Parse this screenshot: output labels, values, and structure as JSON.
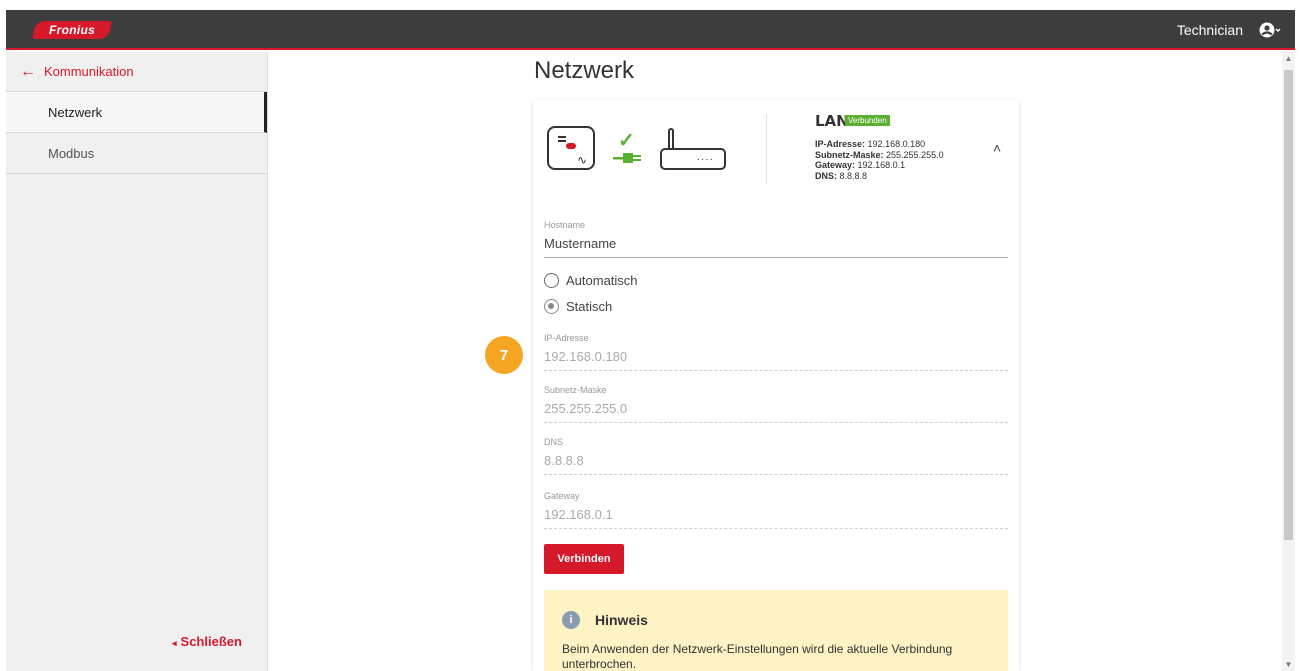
{
  "header": {
    "logo_text": "Fronius",
    "user_label": "Technician"
  },
  "sidebar": {
    "back_label": "Kommunikation",
    "items": [
      {
        "label": "Netzwerk",
        "active": true
      },
      {
        "label": "Modbus",
        "active": false
      }
    ],
    "close_label": "Schließen"
  },
  "main": {
    "title": "Netzwerk"
  },
  "lan": {
    "title": "LAN",
    "status_badge": "Verbunden",
    "ip_label": "IP-Adresse:",
    "ip_value": "192.168.0.180",
    "subnet_label": "Subnetz-Maske:",
    "subnet_value": "255.255.255.0",
    "gateway_label": "Gateway:",
    "gateway_value": "192.168.0.1",
    "dns_label": "DNS:",
    "dns_value": "8.8.8.8"
  },
  "form": {
    "hostname_label": "Hostname",
    "hostname_value": "Mustername",
    "radio_auto": "Automatisch",
    "radio_static": "Statisch",
    "selected_mode": "Statisch",
    "ip_label": "IP-Adresse",
    "ip_value": "192.168.0.180",
    "subnet_label": "Subnetz-Maske",
    "subnet_value": "255.255.255.0",
    "dns_label": "DNS",
    "dns_value": "8.8.8.8",
    "gateway_label": "Gateway",
    "gateway_value": "192.168.0.1",
    "connect_button": "Verbinden"
  },
  "hint": {
    "title": "Hinweis",
    "text": "Beim Anwenden der Netzwerk-Einstellungen wird die aktuelle Verbindung unterbrochen."
  },
  "annotation": {
    "step_number": "7"
  },
  "colors": {
    "brand_red": "#d6182b",
    "topbar_bg": "#3d3d3d",
    "success_green": "#5bb030",
    "hint_bg": "#fdf3c4",
    "marker_orange": "#f5a623"
  }
}
